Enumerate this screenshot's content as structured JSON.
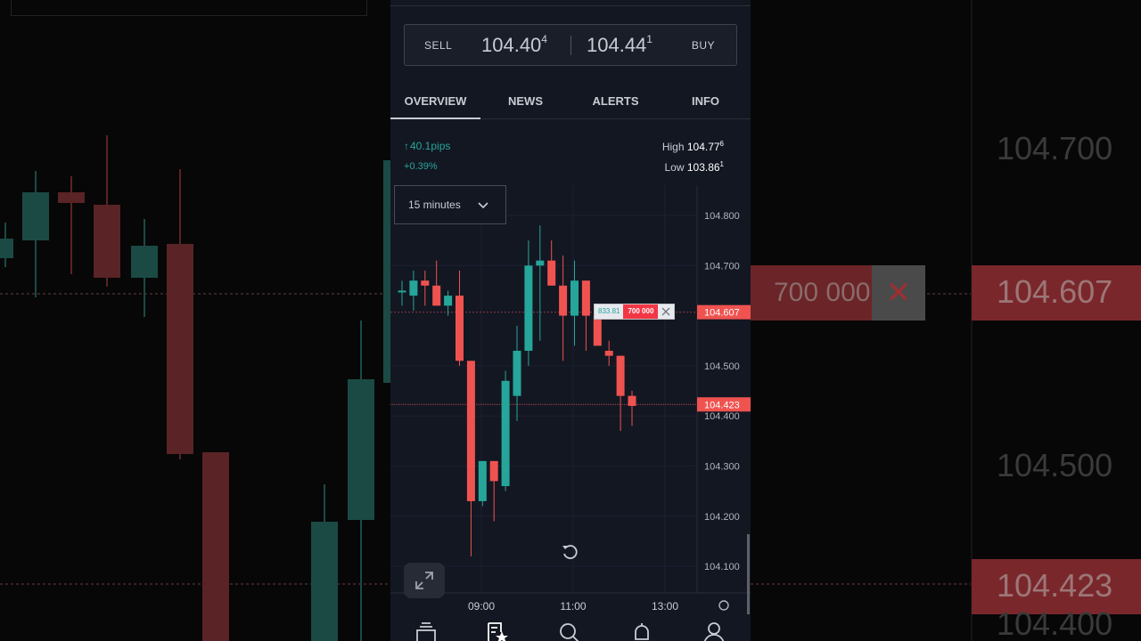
{
  "trade": {
    "sell_label": "SELL",
    "sell_price_main": "104.40",
    "sell_price_sup": "4",
    "buy_price_main": "104.44",
    "buy_price_sup": "1",
    "buy_label": "BUY"
  },
  "tabs": [
    {
      "label": "OVERVIEW",
      "active": true
    },
    {
      "label": "NEWS",
      "active": false
    },
    {
      "label": "ALERTS",
      "active": false
    },
    {
      "label": "INFO",
      "active": false
    }
  ],
  "stats": {
    "change": "40.1pips",
    "change_pct": "+0.39%",
    "high_label": "High",
    "high_value": "104.77",
    "high_sup": "6",
    "low_label": "Low",
    "low_value": "103.86",
    "low_sup": "1"
  },
  "timeframe": {
    "label": "15 minutes"
  },
  "order": {
    "price": "833.81",
    "quantity": "700 000"
  },
  "chart_data": {
    "type": "candlestick",
    "y_ticks": [
      "104.800",
      "104.700",
      "104.500",
      "104.400",
      "104.300",
      "104.200",
      "104.100"
    ],
    "x_ticks": [
      "09:00",
      "11:00",
      "13:00"
    ],
    "ylim": [
      104.04,
      104.86
    ],
    "price_tags": [
      {
        "label": "104.607",
        "value": 104.607
      },
      {
        "label": "104.423",
        "value": 104.423
      }
    ],
    "candles": [
      {
        "o": 104.65,
        "h": 104.67,
        "l": 104.62,
        "c": 104.65
      },
      {
        "o": 104.64,
        "h": 104.69,
        "l": 104.61,
        "c": 104.67
      },
      {
        "o": 104.67,
        "h": 104.69,
        "l": 104.62,
        "c": 104.66
      },
      {
        "o": 104.66,
        "h": 104.71,
        "l": 104.62,
        "c": 104.62
      },
      {
        "o": 104.62,
        "h": 104.65,
        "l": 104.6,
        "c": 104.64
      },
      {
        "o": 104.64,
        "h": 104.69,
        "l": 104.5,
        "c": 104.51
      },
      {
        "o": 104.51,
        "h": 104.51,
        "l": 104.12,
        "c": 104.23
      },
      {
        "o": 104.23,
        "h": 104.31,
        "l": 104.22,
        "c": 104.31
      },
      {
        "o": 104.31,
        "h": 104.31,
        "l": 104.19,
        "c": 104.27
      },
      {
        "o": 104.26,
        "h": 104.49,
        "l": 104.25,
        "c": 104.47
      },
      {
        "o": 104.44,
        "h": 104.58,
        "l": 104.39,
        "c": 104.53
      },
      {
        "o": 104.53,
        "h": 104.75,
        "l": 104.5,
        "c": 104.7
      },
      {
        "o": 104.7,
        "h": 104.78,
        "l": 104.55,
        "c": 104.71
      },
      {
        "o": 104.71,
        "h": 104.75,
        "l": 104.67,
        "c": 104.66
      },
      {
        "o": 104.66,
        "h": 104.72,
        "l": 104.51,
        "c": 104.6
      },
      {
        "o": 104.6,
        "h": 104.71,
        "l": 104.54,
        "c": 104.67
      },
      {
        "o": 104.67,
        "h": 104.67,
        "l": 104.53,
        "c": 104.6
      },
      {
        "o": 104.6,
        "h": 104.61,
        "l": 104.55,
        "c": 104.54
      },
      {
        "o": 104.53,
        "h": 104.55,
        "l": 104.5,
        "c": 104.52
      },
      {
        "o": 104.52,
        "h": 104.52,
        "l": 104.37,
        "c": 104.44
      },
      {
        "o": 104.44,
        "h": 104.45,
        "l": 104.38,
        "c": 104.42
      }
    ],
    "up_color": "#26a69a",
    "down_color": "#ef5350"
  },
  "background": {
    "left_prices": [],
    "right_prices": [
      "104.700",
      "104.607",
      "104.500",
      "104.423",
      "104.400"
    ],
    "right_tag_qty": "700 000"
  },
  "nav": [
    {
      "icon": "wallet-icon"
    },
    {
      "icon": "watchlist-icon"
    },
    {
      "icon": "search-icon"
    },
    {
      "icon": "bell-icon"
    },
    {
      "icon": "profile-icon"
    }
  ]
}
